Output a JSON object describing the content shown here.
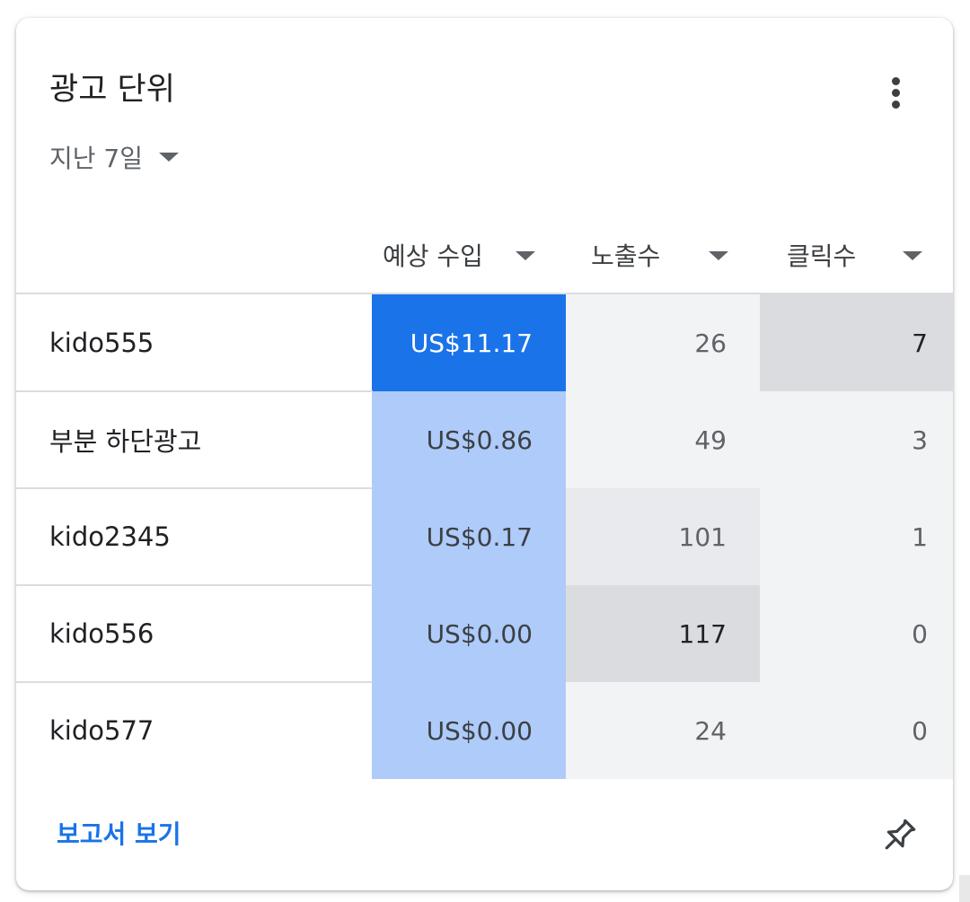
{
  "card": {
    "title": "광고 단위",
    "more_icon": "more-vert-icon",
    "period": {
      "label": "지난 7일",
      "icon": "caret-down-icon"
    },
    "columns": [
      {
        "label": "예상 수입",
        "icon": "caret-down-icon"
      },
      {
        "label": "노출수",
        "icon": "caret-down-icon"
      },
      {
        "label": "클릭수",
        "icon": "caret-down-icon"
      }
    ],
    "rows": [
      {
        "name": "kido555",
        "revenue": "US$11.17",
        "impressions": "26",
        "clicks": "7"
      },
      {
        "name": "부분 하단광고",
        "revenue": "US$0.86",
        "impressions": "49",
        "clicks": "3"
      },
      {
        "name": "kido2345",
        "revenue": "US$0.17",
        "impressions": "101",
        "clicks": "1"
      },
      {
        "name": "kido556",
        "revenue": "US$0.00",
        "impressions": "117",
        "clicks": "0"
      },
      {
        "name": "kido577",
        "revenue": "US$0.00",
        "impressions": "24",
        "clicks": "0"
      }
    ],
    "footer": {
      "report_link": "보고서 보기",
      "pin_icon": "pin-icon"
    }
  },
  "colors": {
    "accent": "#1a73e8",
    "revenue_top": "#1a73e8",
    "revenue_other": "#aecbfa",
    "heat_base": "#f1f3f4",
    "heat_mid": "#e8eaed",
    "heat_high": "#dadce0"
  }
}
